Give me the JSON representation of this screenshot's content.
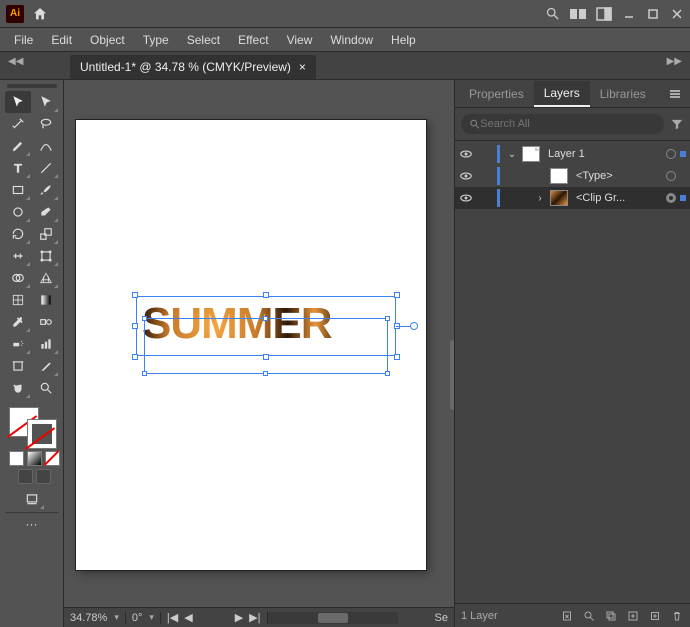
{
  "titlebar": {
    "app_badge": "Ai"
  },
  "menubar": {
    "items": [
      "File",
      "Edit",
      "Object",
      "Type",
      "Select",
      "Effect",
      "View",
      "Window",
      "Help"
    ]
  },
  "tabs": {
    "doc_title": "Untitled-1* @ 34.78 % (CMYK/Preview)",
    "close": "×"
  },
  "canvas": {
    "text": "SUMMER"
  },
  "statusbar": {
    "zoom": "34.78%",
    "rotate": "0°",
    "se": "Se"
  },
  "panels": {
    "tabs": {
      "properties": "Properties",
      "layers": "Layers",
      "libraries": "Libraries"
    },
    "search_placeholder": "Search All",
    "layers": {
      "l1": "Layer 1",
      "l2": "<Type>",
      "l3": "<Clip Gr..."
    },
    "footer": {
      "count": "1 Layer"
    }
  }
}
